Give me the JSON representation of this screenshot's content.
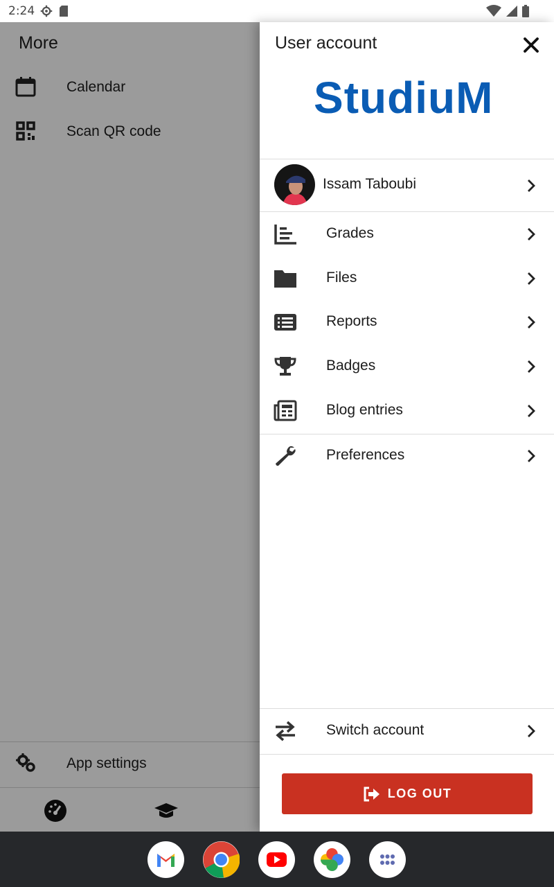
{
  "status_bar": {
    "time": "2:24",
    "icons": [
      "settings-gear-icon",
      "sd-card-icon",
      "wifi-icon",
      "signal-icon",
      "battery-icon"
    ]
  },
  "background": {
    "title": "More",
    "items": [
      {
        "label": "Calendar",
        "icon": "calendar-icon"
      },
      {
        "label": "Scan QR code",
        "icon": "qr-code-icon"
      }
    ],
    "app_settings": {
      "label": "App settings",
      "icon": "gears-icon"
    },
    "tabs": [
      "dashboard-icon",
      "graduation-cap-icon"
    ]
  },
  "drawer": {
    "title": "User account",
    "logo_text": "StudiuM",
    "user": {
      "name": "Issam Taboubi"
    },
    "menu": [
      {
        "label": "Grades",
        "icon": "grades-chart-icon"
      },
      {
        "label": "Files",
        "icon": "folder-icon"
      },
      {
        "label": "Reports",
        "icon": "list-icon"
      },
      {
        "label": "Badges",
        "icon": "trophy-icon"
      },
      {
        "label": "Blog entries",
        "icon": "newspaper-icon"
      }
    ],
    "preferences": {
      "label": "Preferences",
      "icon": "wrench-icon"
    },
    "switch_account": {
      "label": "Switch account",
      "icon": "swap-arrows-icon"
    },
    "logout": {
      "label": "LOG OUT",
      "icon": "logout-icon"
    },
    "colors": {
      "logo": "#0a5cb4",
      "logout_bg": "#c93121"
    }
  },
  "dock": {
    "apps": [
      "Gmail",
      "Chrome",
      "YouTube",
      "Photos",
      "App drawer"
    ]
  }
}
